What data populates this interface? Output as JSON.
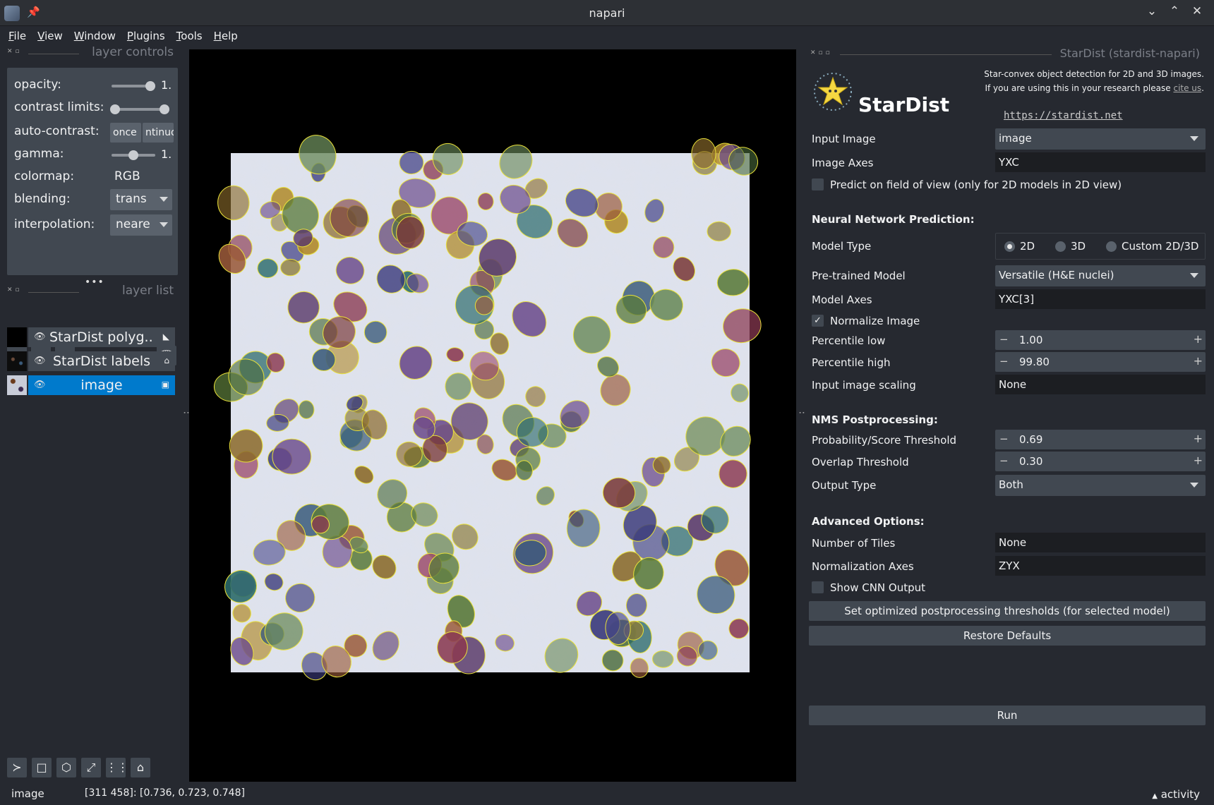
{
  "window": {
    "title": "napari"
  },
  "menu": [
    "File",
    "View",
    "Window",
    "Plugins",
    "Tools",
    "Help"
  ],
  "layer_controls": {
    "title": "layer controls",
    "opacity_label": "opacity:",
    "opacity_value": "1.",
    "opacity": 1.0,
    "contrast_label": "contrast limits:",
    "autocontrast_label": "auto-contrast:",
    "autocontrast_once": "once",
    "autocontrast_continuous": "ntinuo",
    "gamma_label": "gamma:",
    "gamma_value": "1.",
    "colormap_label": "colormap:",
    "colormap_value": "RGB",
    "blending_label": "blending:",
    "blending_value": "trans",
    "interpolation_label": "interpolation:",
    "interpolation_value": "neare"
  },
  "layer_list": {
    "title": "layer list",
    "layers": [
      {
        "name": "StarDist polyg...",
        "type": "shapes",
        "selected": false
      },
      {
        "name": "StarDist labels",
        "type": "labels",
        "selected": false
      },
      {
        "name": "image",
        "type": "image",
        "selected": true
      }
    ]
  },
  "status": {
    "layer": "image",
    "coords": "[311 458]: [0.736, 0.723, 0.748]",
    "activity": "activity"
  },
  "stardist": {
    "dock_title": "StarDist (stardist-napari)",
    "logo_text": "StarDist",
    "badge_text": "StarDist",
    "desc_line1": "Star-convex object detection for 2D and 3D images.",
    "desc_line2": "If you are using this in your research please ",
    "cite": "cite us",
    "desc_end": ".",
    "url": "https://stardist.net",
    "input_image_label": "Input Image",
    "input_image_value": "image",
    "image_axes_label": "Image Axes",
    "image_axes_value": "YXC",
    "predict_fov_label": "Predict on field of view (only for 2D models in 2D view)",
    "nn_header": "Neural Network Prediction:",
    "model_type_label": "Model Type",
    "model_types": [
      "2D",
      "3D",
      "Custom 2D/3D"
    ],
    "pretrained_label": "Pre-trained Model",
    "pretrained_value": "Versatile (H&E nuclei)",
    "model_axes_label": "Model Axes",
    "model_axes_value": "YXC[3]",
    "normalize_label": "Normalize Image",
    "pct_low_label": "Percentile low",
    "pct_low_value": "1.00",
    "pct_high_label": "Percentile high",
    "pct_high_value": "99.80",
    "scaling_label": "Input image scaling",
    "scaling_value": "None",
    "nms_header": "NMS Postprocessing:",
    "prob_label": "Probability/Score Threshold",
    "prob_value": "0.69",
    "overlap_label": "Overlap Threshold",
    "overlap_value": "0.30",
    "output_label": "Output Type",
    "output_value": "Both",
    "adv_header": "Advanced Options:",
    "tiles_label": "Number of Tiles",
    "tiles_value": "None",
    "norm_axes_label": "Normalization Axes",
    "norm_axes_value": "ZYX",
    "cnn_label": "Show CNN Output",
    "set_thresh_btn": "Set optimized postprocessing thresholds (for selected model)",
    "restore_btn": "Restore Defaults",
    "run_btn": "Run"
  },
  "colors": {
    "accent": "#007acc",
    "panel": "#414851",
    "bg": "#262930",
    "outline": "#e8e03a"
  }
}
